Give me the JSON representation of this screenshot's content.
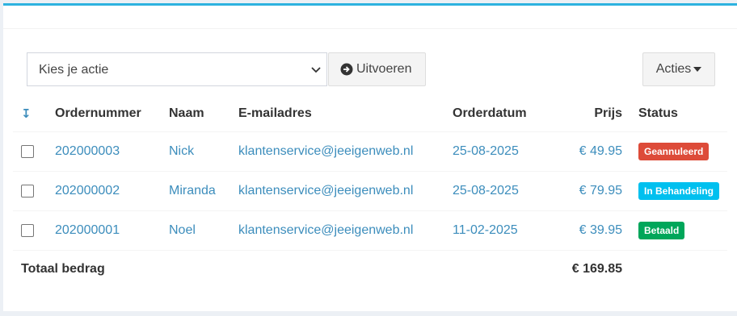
{
  "toolbar": {
    "select_value": "Kies je actie",
    "run_label": "Uitvoeren",
    "actions_label": "Acties"
  },
  "table": {
    "headers": {
      "sort_glyph": "↧",
      "order_number": "Ordernummer",
      "name": "Naam",
      "email": "E-mailadres",
      "order_date": "Orderdatum",
      "price": "Prijs",
      "status": "Status"
    },
    "rows": [
      {
        "order_number": "202000003",
        "name": "Nick",
        "email": "klantenservice@jeeigenweb.nl",
        "order_date": "25-08-2025",
        "price": "€ 49.95",
        "status": "Geannuleerd",
        "status_color": "#dd4b39"
      },
      {
        "order_number": "202000002",
        "name": "Miranda",
        "email": "klantenservice@jeeigenweb.nl",
        "order_date": "25-08-2025",
        "price": "€ 79.95",
        "status": "In Behandeling",
        "status_color": "#00c0ef"
      },
      {
        "order_number": "202000001",
        "name": "Noel",
        "email": "klantenservice@jeeigenweb.nl",
        "order_date": "11-02-2025",
        "price": "€ 39.95",
        "status": "Betaald",
        "status_color": "#00a65a"
      }
    ],
    "footer": {
      "total_label": "Totaal bedrag",
      "total_value": "€ 169.85"
    }
  },
  "icons": {
    "sort": "sort-desc-icon",
    "run": "arrow-circle-right-icon",
    "select": "chevron-down-icon",
    "actions": "caret-down-icon"
  }
}
